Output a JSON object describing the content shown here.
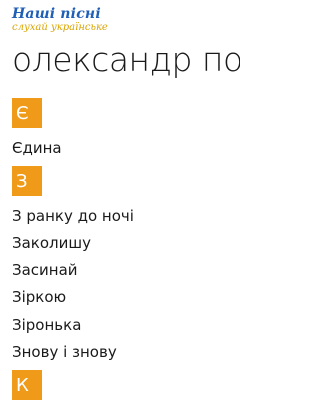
{
  "app": {
    "logo_line1": "Наші пісні",
    "logo_line2": "слухай українське"
  },
  "page_title": "олександр пономарьов",
  "groups": [
    {
      "letter": "Є",
      "songs": [
        "Єдина"
      ]
    },
    {
      "letter": "З",
      "songs": [
        "З ранку до ночі",
        "Заколишу",
        "Засинай",
        "Зіркою",
        "Зіронька",
        "Знову і знову"
      ]
    },
    {
      "letter": "К",
      "songs": []
    }
  ],
  "colors": {
    "accent": "#f09a1a",
    "logo_blue": "#1f5fb6",
    "logo_yellow": "#d9a400"
  }
}
